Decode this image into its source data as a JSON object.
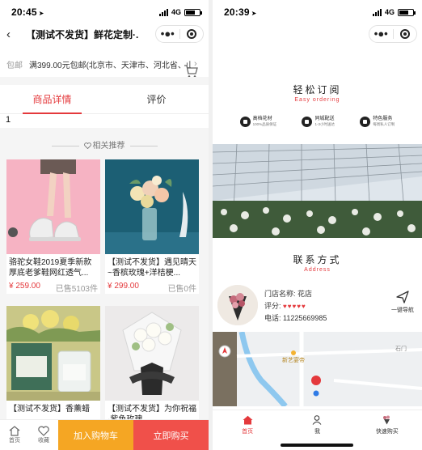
{
  "left": {
    "status": {
      "time": "20:45",
      "network": "4G"
    },
    "nav": {
      "back": "‹",
      "title": "【测试不发货】鲜花定制·..."
    },
    "shipping": {
      "label": "包邮",
      "text": "满399.00元包邮(北京市、天津市、河北省、山..."
    },
    "tabs": [
      "商品详情",
      "评价"
    ],
    "page_number": "1",
    "related_title": "相关推荐",
    "products": [
      {
        "name": "骆驼女鞋2019夏季新款厚底老爹鞋网红透气...",
        "price": "¥ 259.00",
        "sold": "已售5103件"
      },
      {
        "name": "【测试不发货】遇见晴天~香槟玫瑰+洋桔梗...",
        "price": "¥ 299.00",
        "sold": "已售0件"
      },
      {
        "name": "【测试不发货】香薰蜡",
        "price": "",
        "sold": ""
      },
      {
        "name": "【测试不发货】为你祝福·紫色玫瑰",
        "price": "",
        "sold": ""
      }
    ],
    "bottom": {
      "home": "首页",
      "fav": "收藏",
      "cart": "加入购物车",
      "buy": "立即购买"
    }
  },
  "right": {
    "status": {
      "time": "20:39",
      "network": "4G"
    },
    "subscribe": {
      "title": "轻松订阅",
      "subtitle": "Easy ordering"
    },
    "features": [
      {
        "title": "高档花材",
        "sub": "100%品质保证"
      },
      {
        "title": "同城配送",
        "sub": "1-3小时送达"
      },
      {
        "title": "特色服务",
        "sub": "每周私人订制"
      }
    ],
    "contact": {
      "title": "联系方式",
      "subtitle": "Address"
    },
    "shop": {
      "name": "门店名称: 花店",
      "rating_label": "评分:",
      "stars": "♥♥♥♥♥",
      "phone": "电话: 11225669985",
      "nav_label": "一键导航"
    },
    "map": {
      "poi": "新艺宴帝",
      "street": "石门"
    },
    "tabbar": [
      "首页",
      "我",
      "快速购买"
    ]
  },
  "colors": {
    "accent": "#e4393c",
    "cart": "#f5a623",
    "buy": "#f0504a"
  }
}
